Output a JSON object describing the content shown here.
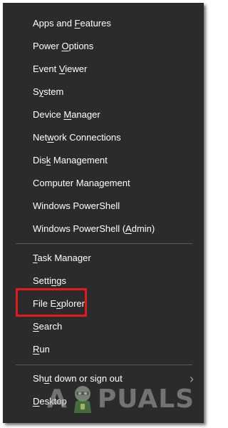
{
  "menu": {
    "groups": [
      [
        {
          "pre": "Apps and ",
          "acc": "F",
          "post": "eatures"
        },
        {
          "pre": "Power ",
          "acc": "O",
          "post": "ptions"
        },
        {
          "pre": "Event ",
          "acc": "V",
          "post": "iewer"
        },
        {
          "pre": "S",
          "acc": "y",
          "post": "stem"
        },
        {
          "pre": "Device ",
          "acc": "M",
          "post": "anager"
        },
        {
          "pre": "Net",
          "acc": "w",
          "post": "ork Connections"
        },
        {
          "pre": "Dis",
          "acc": "k",
          "post": " Management"
        },
        {
          "pre": "Computer Mana",
          "acc": "g",
          "post": "ement"
        },
        {
          "pre": "Windows PowerShell",
          "acc": "",
          "post": ""
        },
        {
          "pre": "Windows PowerShell (",
          "acc": "A",
          "post": "dmin)"
        }
      ],
      [
        {
          "pre": "",
          "acc": "T",
          "post": "ask Manager"
        },
        {
          "pre": "Setti",
          "acc": "n",
          "post": "gs"
        },
        {
          "pre": "File E",
          "acc": "x",
          "post": "plorer"
        },
        {
          "pre": "",
          "acc": "S",
          "post": "earch"
        },
        {
          "pre": "",
          "acc": "R",
          "post": "un"
        }
      ],
      [
        {
          "pre": "Sh",
          "acc": "u",
          "post": "t down or sign out"
        },
        {
          "pre": "",
          "acc": "D",
          "post": "esktop"
        }
      ]
    ],
    "submenu_chevron": "›"
  },
  "highlight": {
    "color": "#e01b1b"
  },
  "colors": {
    "menu_bg": "#2b2b2b",
    "text": "#ffffff",
    "separator": "#5a5a5a"
  },
  "watermark": {
    "left": "A",
    "right": "PUALS"
  }
}
